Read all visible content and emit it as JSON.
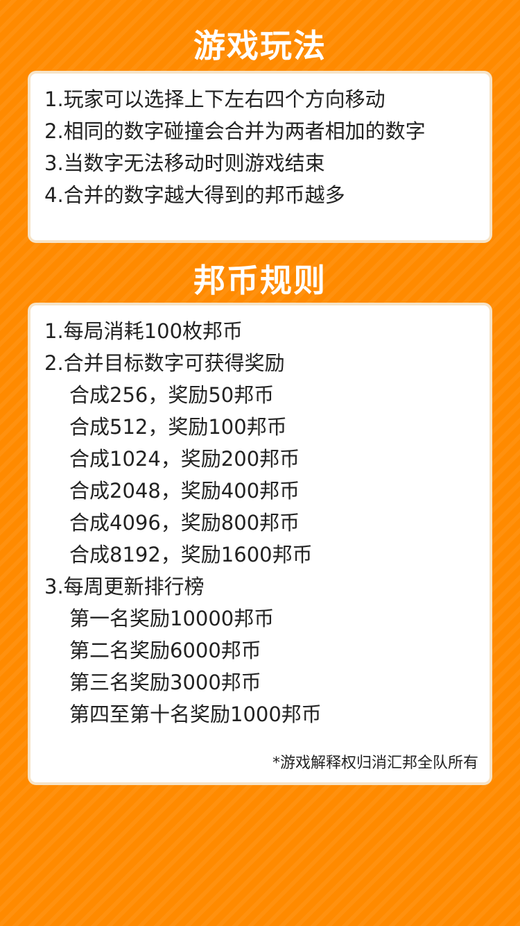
{
  "gameplay": {
    "title": "游戏玩法",
    "items": [
      "1.玩家可以选择上下左右四个方向移动",
      "2.相同的数字碰撞会合并为两者相加的数字",
      "3.当数字无法移动时则游戏结束",
      "4.合并的数字越大得到的邦币越多"
    ]
  },
  "coin_rules": {
    "title": "邦币规则",
    "lines": [
      "1.每局消耗100枚邦币",
      "2.合并目标数字可获得奖励",
      "合成256，奖励50邦币",
      "合成512，奖励100邦币",
      "合成1024，奖励200邦币",
      "合成2048，奖励400邦币",
      "合成4096，奖励800邦币",
      "合成8192，奖励1600邦币",
      "3.每周更新排行榜",
      "第一名奖励10000邦币",
      "第二名奖励6000邦币",
      "第三名奖励3000邦币",
      "第四至第十名奖励1000邦币"
    ],
    "footnote": "*游戏解释权归消汇邦全队所有"
  },
  "colors": {
    "background": "#ff8a00",
    "card": "#ffffff",
    "card_border": "#f6e3c7",
    "title_text": "#ffffff",
    "body_text": "#222222"
  }
}
